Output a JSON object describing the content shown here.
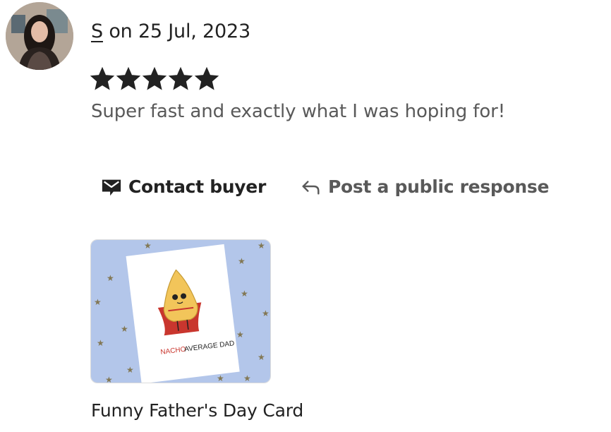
{
  "review": {
    "reviewer_initial": "S",
    "date_text": "on 25 Jul, 2023",
    "rating": 5,
    "rating_max": 5,
    "text": "Super fast and exactly what I was hoping for!"
  },
  "actions": {
    "contact_label": "Contact buyer",
    "respond_label": "Post a public response"
  },
  "product": {
    "title": "Funny Father's Day Card",
    "card_text_red": "NACHO",
    "card_text_black": "AVERAGE DAD"
  },
  "icons": {
    "avatar": "user-avatar",
    "star": "star-icon",
    "contact": "envelope-icon",
    "respond": "reply-arrow-icon"
  },
  "colors": {
    "text": "#222222",
    "muted": "#595959",
    "card_bg": "#b3c6ea",
    "accent_red": "#c0392b"
  }
}
